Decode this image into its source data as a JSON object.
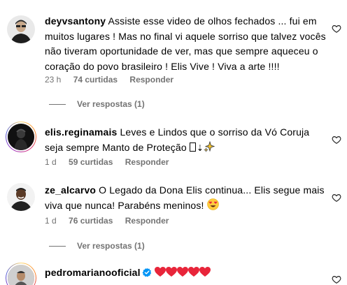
{
  "comments": [
    {
      "username": "deyvsantony",
      "text": "Assiste esse video de olhos fechados ... fui em muitos lugares ! Mas no final vi aquele sorriso que talvez vocês não tiveram oportunidade de ver, mas que sempre aqueceu o coração do povo brasileiro ! Elis Vive ! Viva a arte !!!!",
      "time": "23 h",
      "likes": "74 curtidas",
      "reply": "Responder",
      "view_replies": "Ver respostas (1)"
    },
    {
      "username": "elis.reginamais",
      "text": "Leves e Lindos que o sorriso da Vó Coruja seja sempre Manto de Proteção",
      "time": "1 d",
      "likes": "59 curtidas",
      "reply": "Responder"
    },
    {
      "username": "ze_alcarvo",
      "text": "O Legado da Dona Elis continua... Elis segue mais viva que nunca! Parabéns meninos!",
      "time": "1 d",
      "likes": "76 curtidas",
      "reply": "Responder",
      "view_replies": "Ver respostas (1)"
    },
    {
      "username": "pedromarianooficial",
      "text": ""
    }
  ],
  "colors": {
    "secondary_text": "#737373",
    "verified_blue": "#0095f6",
    "heart_red": "#ff3040"
  },
  "icons": {
    "like": "heart-outline-icon",
    "verified": "verified-badge-icon"
  }
}
